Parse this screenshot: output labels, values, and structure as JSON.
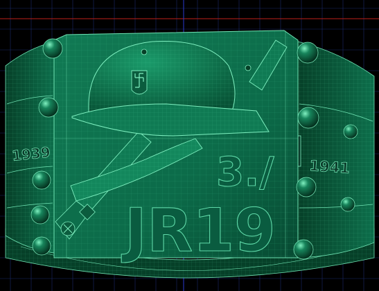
{
  "viewport": {
    "background": "#000000",
    "grid_color": "#1a2a6a",
    "axis_red": "#c0201a",
    "axis_blue": "#2a3ad0"
  },
  "model": {
    "body_color": "#0c6b49",
    "edge_color": "#6fe3b3",
    "shadow_color": "#053a26",
    "front_line_1": "3./",
    "front_line_2": "JR19",
    "left_side_text": "1939",
    "right_side_text": "1941",
    "helmet_emblem": "swastika-emblem",
    "studs": [
      "stud-icon"
    ]
  }
}
